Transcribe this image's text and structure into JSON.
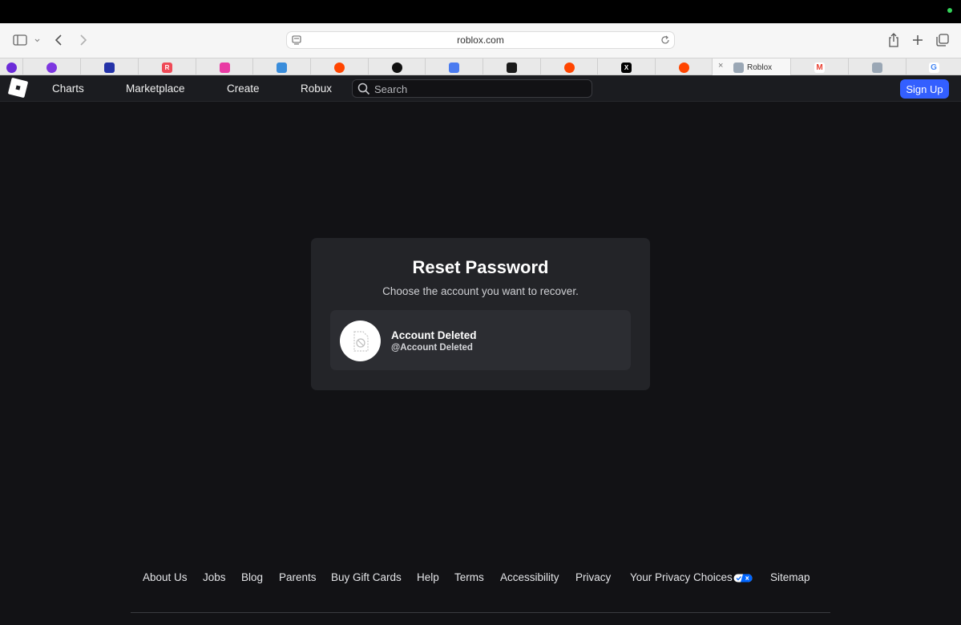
{
  "browser": {
    "url": "roblox.com",
    "tabs": [
      {
        "icon": "purple-circle-favicon",
        "color": "#6b2bd8",
        "glyph": ""
      },
      {
        "icon": "purple-circle-favicon",
        "color": "#7d37e0",
        "glyph": ""
      },
      {
        "icon": "blue-square-favicon",
        "color": "#2432a8",
        "glyph": ""
      },
      {
        "icon": "red-r-favicon",
        "color": "#ef4a57",
        "glyph": "R"
      },
      {
        "icon": "pink-triangle-favicon",
        "color": "#e93ba4",
        "glyph": ""
      },
      {
        "icon": "blue-e-favicon",
        "color": "#3a8ddb",
        "glyph": ""
      },
      {
        "icon": "reddit-favicon",
        "color": "#ff4500",
        "glyph": ""
      },
      {
        "icon": "black-circle-favicon",
        "color": "#111111",
        "glyph": ""
      },
      {
        "icon": "blue-app-favicon",
        "color": "#4a7bf0",
        "glyph": ""
      },
      {
        "icon": "black-purple-favicon",
        "color": "#1a1a1a",
        "glyph": ""
      },
      {
        "icon": "reddit-favicon",
        "color": "#ff4500",
        "glyph": ""
      },
      {
        "icon": "x-favicon",
        "color": "#000000",
        "glyph": "X"
      },
      {
        "icon": "reddit-favicon",
        "color": "#ff4500",
        "glyph": ""
      },
      {
        "icon": "roblox-favicon",
        "color": "#9aa7b5",
        "glyph": "",
        "title": "Roblox",
        "active": true
      },
      {
        "icon": "gmail-favicon",
        "color": "#ffffff",
        "glyph": "M"
      },
      {
        "icon": "roblox-favicon",
        "color": "#9aa7b5",
        "glyph": ""
      },
      {
        "icon": "google-favicon",
        "color": "#ffffff",
        "glyph": "G"
      }
    ]
  },
  "nav": {
    "links": [
      "Charts",
      "Marketplace",
      "Create",
      "Robux"
    ],
    "search_placeholder": "Search",
    "signup_label": "Sign Up"
  },
  "card": {
    "title": "Reset Password",
    "subtitle": "Choose the account you want to recover.",
    "account": {
      "name": "Account Deleted",
      "handle": "@Account Deleted"
    }
  },
  "footer": {
    "links": [
      "About Us",
      "Jobs",
      "Blog",
      "Parents",
      "Buy Gift Cards",
      "Help",
      "Terms",
      "Accessibility",
      "Privacy",
      "Your Privacy Choices",
      "Sitemap"
    ]
  },
  "colors": {
    "background": "#121215",
    "card": "#232428",
    "accent": "#335fff"
  }
}
